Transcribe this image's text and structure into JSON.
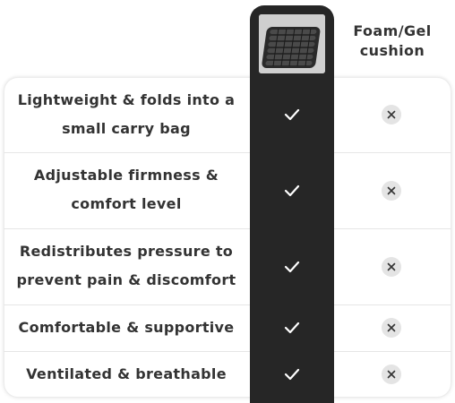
{
  "header": {
    "other_column_title": "Foam/Gel cushion",
    "product_image_icon": "air-cushion-product-photo"
  },
  "features": [
    {
      "label": "Lightweight & folds into a small carry bag",
      "product": true,
      "other": false
    },
    {
      "label": "Adjustable firmness & comfort level",
      "product": true,
      "other": false
    },
    {
      "label": "Redistributes pressure to prevent pain & discomfort",
      "product": true,
      "other": false
    },
    {
      "label": "Comfortable & supportive",
      "product": true,
      "other": false
    },
    {
      "label": "Ventilated & breathable",
      "product": true,
      "other": false
    }
  ],
  "icons": {
    "product_mark": "check-icon",
    "other_mark": "x-icon"
  },
  "colors": {
    "highlight_column": "#262626",
    "check": "#ffffff",
    "x_circle": "#e4e4e4",
    "x_mark": "#333333",
    "text": "#333333"
  }
}
